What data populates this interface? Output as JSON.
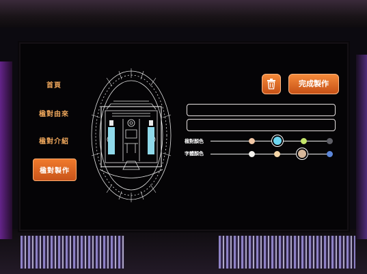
{
  "nav": {
    "items": [
      {
        "label": "首頁"
      },
      {
        "label": "楹對由來"
      },
      {
        "label": "楹對介紹"
      },
      {
        "label": "楹對製作",
        "active": true
      }
    ]
  },
  "toolbar": {
    "delete_icon": "trash-icon",
    "finish_label": "完成製作"
  },
  "inputs": {
    "upper_line_value": "",
    "lower_line_value": ""
  },
  "colors": {
    "couplet_color_label": "楹對顏色",
    "couplet_colors": [
      "#f1c7a6",
      "#6dd7f2",
      "#c4e56a",
      "#5f5f66"
    ],
    "couplet_selected": "#6dd7f2",
    "text_color_label": "字體顏色",
    "text_colors": [
      "#f4f2ee",
      "#f6d7a8",
      "#d7b79a",
      "#5b86d9"
    ],
    "text_selected": "#d7b79a",
    "accent": "#f07a2c"
  }
}
